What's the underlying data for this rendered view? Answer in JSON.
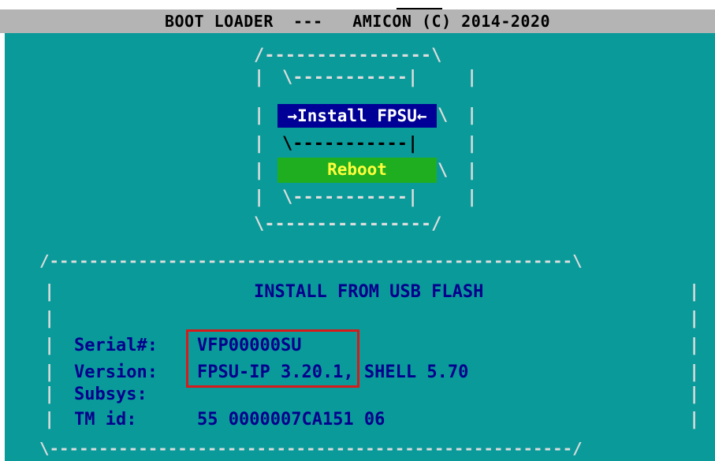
{
  "title_bar": {
    "text": "BOOT LOADER  ---   AMICON (C) 2014-2020"
  },
  "menu_frame": {
    "top": "/----------------\\",
    "bottom": "\\----------------/",
    "inner_sep": "\\-----------|",
    "edge": "|",
    "pointer": "\\"
  },
  "menu": {
    "items": [
      {
        "label": "→Install FPSU←",
        "selected": true,
        "color": "#000096"
      },
      {
        "label": "Reboot",
        "selected": false,
        "color": "#1fae1f"
      }
    ]
  },
  "info_frame": {
    "top": "/-----------------------------------------------------\\",
    "bottom": "\\-----------------------------------------------------/",
    "edge": "|"
  },
  "info": {
    "heading": "INSTALL FROM USB FLASH",
    "rows": [
      {
        "label": "Serial#:",
        "value": "VFP00000SU"
      },
      {
        "label": "Version:",
        "value": "FPSU-IP 3.20.1, SHELL 5.70"
      },
      {
        "label": "Subsys:",
        "value": ""
      },
      {
        "label": "TM id:",
        "value": "55 0000007CA151 06"
      }
    ]
  },
  "colors": {
    "background": "#0a9a9a",
    "title_bar": "#b4b4b4",
    "text_blue": "#00008c",
    "frame_light": "#dddddd",
    "highlight_box": "#d81a1a"
  }
}
